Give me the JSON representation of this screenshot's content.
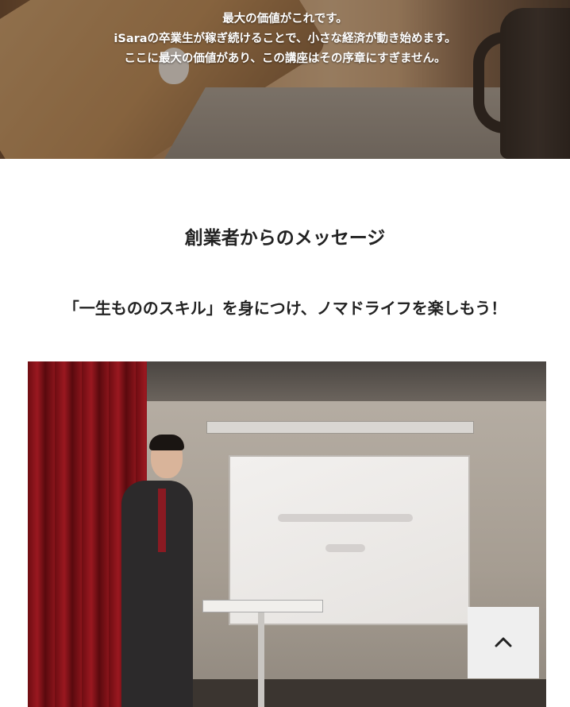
{
  "hero": {
    "lines": [
      "最大の価値がこれです。",
      "iSaraの卒業生が稼ぎ続けることで、小さな経済が動き始めます。",
      "ここに最大の価値があり、この講座はその序章にすぎません。"
    ]
  },
  "section": {
    "title": "創業者からのメッセージ",
    "subtitle": "「一生もののスキル」を身につけ、ノマドライフを楽しもう！"
  },
  "back_to_top": {
    "icon": "chevron-up-icon"
  }
}
